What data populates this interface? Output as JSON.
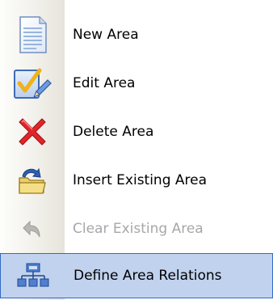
{
  "menu": {
    "items": [
      {
        "label": "New Area",
        "icon": "new-document-icon",
        "enabled": true,
        "selected": false
      },
      {
        "label": "Edit Area",
        "icon": "edit-checkmark-icon",
        "enabled": true,
        "selected": false
      },
      {
        "label": "Delete Area",
        "icon": "delete-x-icon",
        "enabled": true,
        "selected": false
      },
      {
        "label": "Insert Existing Area",
        "icon": "insert-folder-icon",
        "enabled": true,
        "selected": false
      },
      {
        "label": "Clear Existing Area",
        "icon": "clear-arrow-icon",
        "enabled": false,
        "selected": false
      },
      {
        "label": "Define Area Relations",
        "icon": "relations-diagram-icon",
        "enabled": true,
        "selected": true
      }
    ]
  },
  "colors": {
    "selection_fill": "#c1d2ee",
    "selection_border": "#316ac5",
    "disabled_text": "#a7a6aa",
    "delete_red": "#e0262b"
  }
}
